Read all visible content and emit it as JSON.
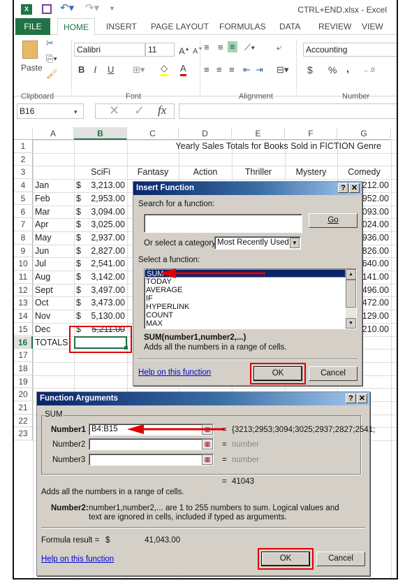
{
  "app": {
    "window_title": "CTRL+END.xlsx - Excel",
    "accent": "#217346"
  },
  "tabs": [
    "FILE",
    "HOME",
    "INSERT",
    "PAGE LAYOUT",
    "FORMULAS",
    "DATA",
    "REVIEW",
    "VIEW"
  ],
  "ribbon": {
    "paste_label": "Paste",
    "font_name": "Calibri",
    "font_size": "11",
    "number_format": "Accounting",
    "groups": [
      "Clipboard",
      "Font",
      "Alignment",
      "Number"
    ],
    "bold": "B",
    "italic": "I",
    "underline": "U",
    "dollar": "$",
    "percent": "%",
    "comma": ","
  },
  "formula_bar": {
    "name_box": "B16",
    "fx": "fx",
    "cancel": "✕",
    "enter": "✓",
    "value": ""
  },
  "sheet": {
    "columns": [
      "A",
      "B",
      "C",
      "D",
      "E",
      "F",
      "G"
    ],
    "rows": [
      "1",
      "2",
      "3",
      "4",
      "5",
      "6",
      "7",
      "8",
      "9",
      "10",
      "11",
      "12",
      "13",
      "14",
      "15",
      "16",
      "17",
      "18",
      "19",
      "20",
      "21",
      "22",
      "23"
    ],
    "title": "Yearly Sales Totals for Books Sold in FICTION Genre",
    "headers": [
      "SciFi",
      "Fantasy",
      "Action",
      "Thriller",
      "Mystery",
      "Comedy"
    ],
    "months": [
      "Jan",
      "Feb",
      "Mar",
      "Apr",
      "May",
      "Jun",
      "Jul",
      "Aug",
      "Sept",
      "Oct",
      "Nov",
      "Dec"
    ],
    "scifi": [
      "3,213.00",
      "2,953.00",
      "3,094.00",
      "3,025.00",
      "2,937.00",
      "2,827.00",
      "2,541.00",
      "3,142.00",
      "3,497.00",
      "3,473.00",
      "5,130.00",
      "5,211.00"
    ],
    "currency": "$",
    "comedy_visible": [
      "212.00",
      "952.00",
      "093.00",
      "024.00",
      "936.00",
      "826.00",
      "640.00",
      "141.00",
      "496.00",
      "472.00",
      "129.00",
      "210.00"
    ],
    "totals_label": "TOTALS",
    "active_cell": "B16"
  },
  "insert_function": {
    "title": "Insert Function",
    "help": "?",
    "close": "✕",
    "search_label": "Search for a function:",
    "search_value": "",
    "go": "Go",
    "category_label": "Or select a category:",
    "category": "Most Recently Used",
    "select_label": "Select a function:",
    "functions": [
      "SUM",
      "TODAY",
      "AVERAGE",
      "IF",
      "HYPERLINK",
      "COUNT",
      "MAX"
    ],
    "selected": "SUM",
    "signature": "SUM(number1,number2,...)",
    "description": "Adds all the numbers in a range of cells.",
    "help_link": "Help on this function",
    "ok": "OK",
    "cancel": "Cancel"
  },
  "function_arguments": {
    "title": "Function Arguments",
    "help": "?",
    "close": "✕",
    "group": "SUM",
    "args": [
      {
        "label": "Number1",
        "value": "B4:B15",
        "result": "{3213;2953;3094;3025;2937;2827;2541;"
      },
      {
        "label": "Number2",
        "value": "",
        "result": "number"
      },
      {
        "label": "Number3",
        "value": "",
        "result": "number"
      }
    ],
    "equals": "=",
    "total": "41043",
    "description": "Adds all the numbers in a range of cells.",
    "arg_name": "Number2:",
    "arg_help_1": "number1,number2,... are 1 to 255 numbers to sum. Logical values and",
    "arg_help_2": "text are ignored in cells, included if typed as arguments.",
    "formula_result_label": "Formula result =",
    "formula_result_currency": "$",
    "formula_result_value": "41,043.00",
    "help_link": "Help on this function",
    "ok": "OK",
    "cancel": "Cancel"
  },
  "annotations": {
    "highlight_color": "#e00000"
  }
}
